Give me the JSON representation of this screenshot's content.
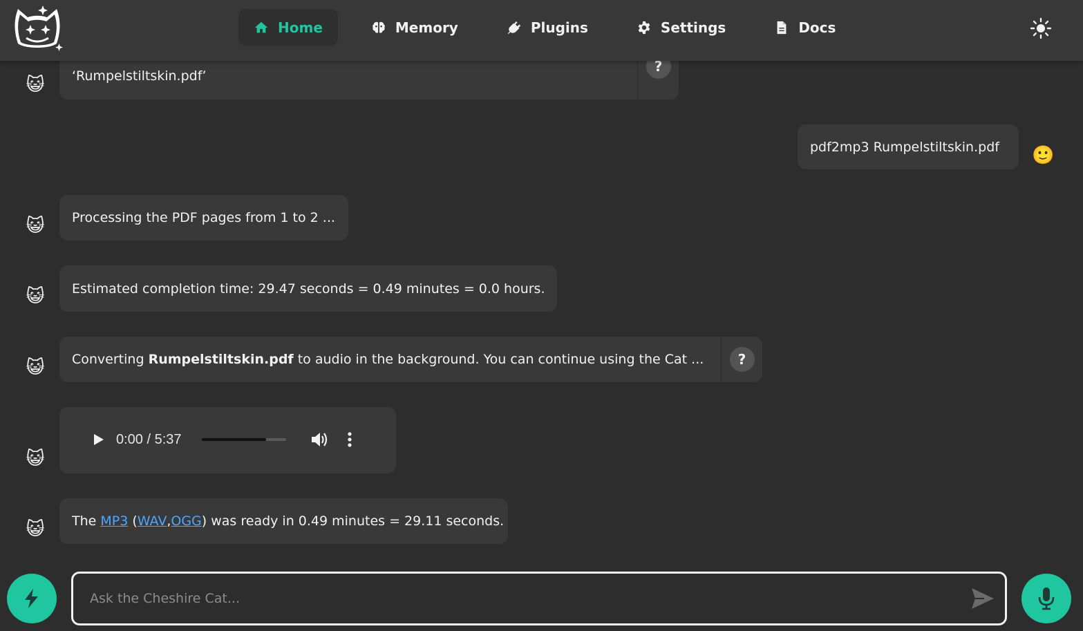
{
  "nav": {
    "items": [
      {
        "label": "Home",
        "icon": "home-icon",
        "active": true
      },
      {
        "label": "Memory",
        "icon": "brain-icon",
        "active": false
      },
      {
        "label": "Plugins",
        "icon": "plug-icon",
        "active": false
      },
      {
        "label": "Settings",
        "icon": "gear-icon",
        "active": false
      },
      {
        "label": "Docs",
        "icon": "document-icon",
        "active": false
      }
    ],
    "theme_icon": "sun-icon"
  },
  "colors": {
    "accent": "#1fc6a0",
    "background": "#2d2d2d",
    "bubble": "#393939",
    "header": "#383838",
    "link": "#4aa8ff"
  },
  "messages": [
    {
      "sender": "cat",
      "avatar": "😺",
      "text": "‘Rumpelstiltskin.pdf’"
    },
    {
      "sender": "user",
      "avatar": "🙂",
      "text": "pdf2mp3 Rumpelstiltskin.pdf"
    },
    {
      "sender": "cat",
      "avatar": "😺",
      "text": "Processing the PDF pages from 1 to 2 ..."
    },
    {
      "sender": "cat",
      "avatar": "😺",
      "text": "Estimated completion time: 29.47 seconds = 0.49 minutes = 0.0 hours."
    },
    {
      "sender": "cat",
      "avatar": "😺",
      "text_before": "Converting ",
      "text_bold": "Rumpelstiltskin.pdf",
      "text_after": " to audio in the background. You can continue using the Cat ..."
    },
    {
      "sender": "cat",
      "avatar": "😺",
      "audio": {
        "current_time": "0:00",
        "duration": "5:37",
        "time_display": "0:00 / 5:37",
        "volume_fraction": 0.76
      }
    },
    {
      "sender": "cat",
      "avatar": "😺",
      "text_before": "The ",
      "link1": "MP3",
      "paren_open": " (",
      "link2": "WAV",
      "comma": ",",
      "link3": "OGG",
      "text_after": ") was ready in 0.49 minutes = 29.11 seconds."
    }
  ],
  "help_label": "?",
  "input": {
    "placeholder": "Ask the Cheshire Cat...",
    "value": ""
  }
}
